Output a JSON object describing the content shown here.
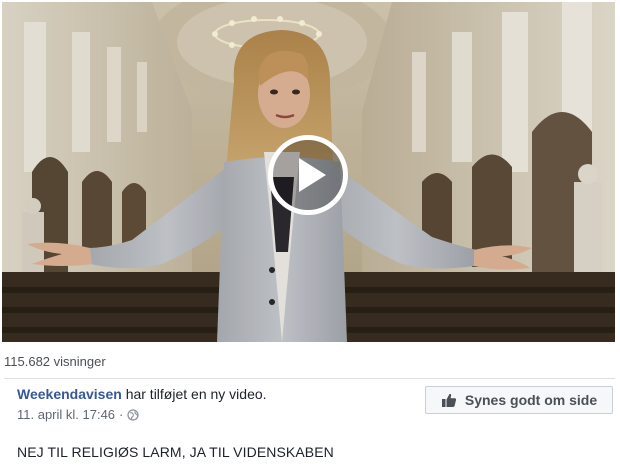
{
  "video": {
    "view_count": "115.682 visninger",
    "play_icon": "play-icon"
  },
  "post": {
    "author": "Weekendavisen",
    "action": "har tilføjet en ny video.",
    "timestamp": "11. april kl. 17:46",
    "separator": "·",
    "privacy_icon": "globe-icon",
    "text": "NEJ TIL RELIGIØS LARM, JA TIL VIDENSKABEN"
  },
  "like_button": {
    "label": "Synes godt om side",
    "icon": "thumbs-up-icon"
  }
}
